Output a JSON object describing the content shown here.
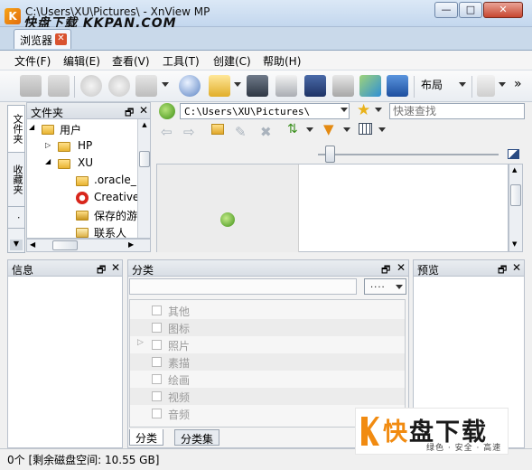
{
  "window": {
    "title": "C:\\Users\\XU\\Pictures\\ - XnView MP",
    "watermark_text": "快盘下载 KKPAN.COM",
    "buttons": {
      "minimize": "—",
      "maximize": "□",
      "close": "✕"
    }
  },
  "tabs": [
    {
      "label": "浏览器",
      "close": "✕"
    }
  ],
  "menu": [
    "文件(F)",
    "编辑(E)",
    "查看(V)",
    "工具(T)",
    "创建(C)",
    "帮助(H)"
  ],
  "toolbar": {
    "layout_label": "布局",
    "overflow": "»"
  },
  "left_vertical_tabs": [
    "文件夹",
    "收藏夹",
    "·"
  ],
  "folder_panel": {
    "title": "文件夹",
    "pin": "🗗",
    "close": "✕",
    "tree": [
      {
        "label": "用户",
        "level": 0,
        "expander": "◢"
      },
      {
        "label": "HP",
        "level": 1,
        "expander": "▷"
      },
      {
        "label": "XU",
        "level": 1,
        "expander": "◢"
      },
      {
        "label": ".oracle_",
        "level": 2,
        "expander": ""
      },
      {
        "label": "Creative",
        "level": 2,
        "expander": ""
      },
      {
        "label": "保存的游",
        "level": 2,
        "expander": ""
      },
      {
        "label": "联系人",
        "level": 2,
        "expander": ""
      }
    ]
  },
  "address_bar": {
    "path": "C:\\Users\\XU\\Pictures\\",
    "quick_search_placeholder": "快速查找"
  },
  "info_panel": {
    "title": "信息"
  },
  "category_panel": {
    "title": "分类",
    "dropdown_label": "....",
    "items": [
      {
        "label": "其他",
        "expander": ""
      },
      {
        "label": "图标",
        "expander": ""
      },
      {
        "label": "照片",
        "expander": "▷"
      },
      {
        "label": "素描",
        "expander": ""
      },
      {
        "label": "绘画",
        "expander": ""
      },
      {
        "label": "视频",
        "expander": ""
      },
      {
        "label": "音频",
        "expander": ""
      }
    ],
    "bottom_tabs": [
      "分类",
      "分类集"
    ]
  },
  "preview_panel": {
    "title": "预览"
  },
  "status": {
    "text": "0个 [剩余磁盘空间: 10.55 GB]"
  },
  "logo": {
    "brand": "快盘下载",
    "first_char": "快",
    "rest": "盘下载",
    "tagline": "绿色 · 安全 · 高速"
  }
}
